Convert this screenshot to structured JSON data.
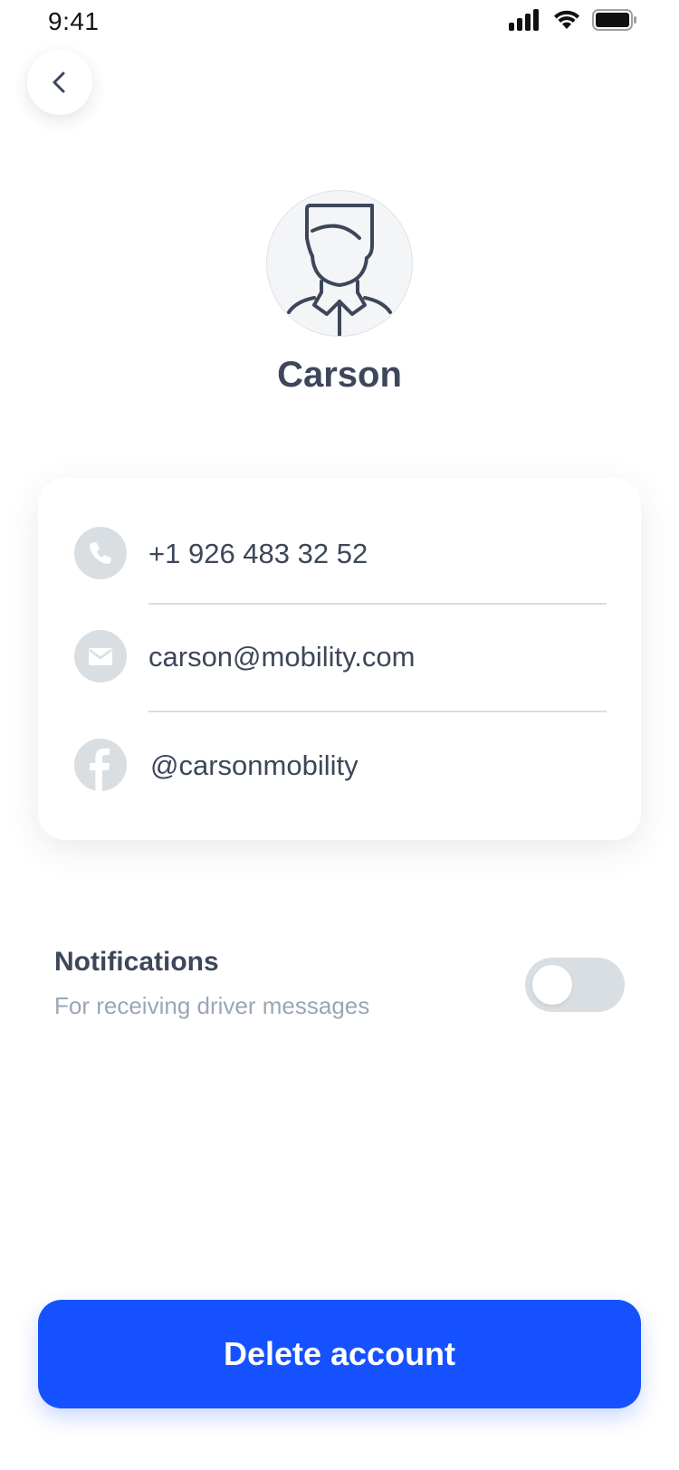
{
  "status_bar": {
    "time": "9:41",
    "icons": [
      "cellular-signal-icon",
      "wifi-icon",
      "battery-icon"
    ]
  },
  "header": {
    "back_icon": "chevron-left-icon"
  },
  "profile": {
    "avatar_icon": "user-avatar-icon",
    "name": "Carson"
  },
  "contacts": [
    {
      "icon": "phone-icon",
      "value": "+1 926 483 32 52"
    },
    {
      "icon": "mail-icon",
      "value": "carson@mobility.com"
    },
    {
      "icon": "facebook-icon",
      "value": "@carsonmobility"
    }
  ],
  "notifications": {
    "title": "Notifications",
    "subtitle": "For receiving driver messages",
    "enabled": false
  },
  "actions": {
    "delete_label": "Delete account"
  },
  "colors": {
    "primary": "#1551ff",
    "text": "#3d4759",
    "muted_text": "#9aa6b5",
    "icon_bg": "#d9dee2"
  }
}
